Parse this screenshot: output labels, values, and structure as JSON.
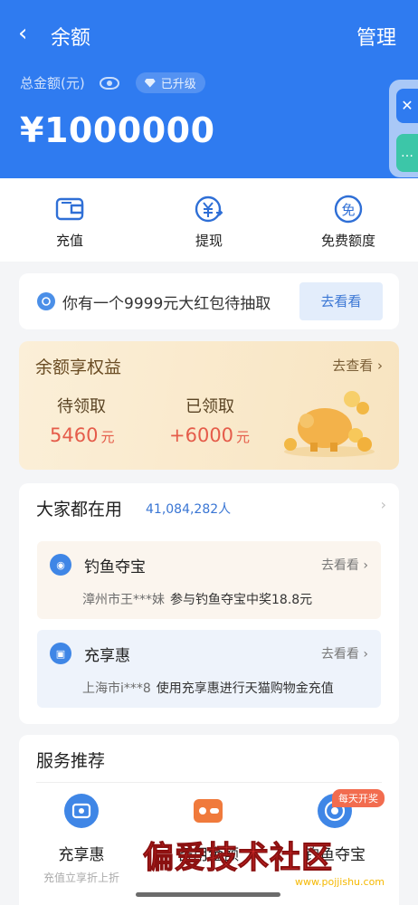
{
  "header": {
    "title": "余额",
    "manage": "管理",
    "total_label": "总金额(元)",
    "upgraded_badge": "已升级",
    "amount": "¥1000000"
  },
  "actions": [
    {
      "label": "充值",
      "icon": "wallet-icon"
    },
    {
      "label": "提现",
      "icon": "yuan-withdraw-icon"
    },
    {
      "label": "免费额度",
      "icon": "free-quota-icon"
    }
  ],
  "promo": {
    "text": "你有一个9999元大红包待抽取",
    "button": "去看看"
  },
  "rights": {
    "title": "余额享权益",
    "link": "去查看",
    "pending_label": "待领取",
    "pending_value": "5460",
    "received_label": "已领取",
    "received_value": "+6000",
    "unit": "元"
  },
  "popular": {
    "title": "大家都在用",
    "count": "41,084,282人",
    "items": [
      {
        "name": "钓鱼夺宝",
        "link": "去看看",
        "city": "漳州市王***妹",
        "desc": "参与钓鱼夺宝中奖18.8元"
      },
      {
        "name": "充享惠",
        "link": "去看看",
        "city": "上海市i***8",
        "desc": "使用充享惠进行天猫购物金充值"
      }
    ]
  },
  "services": {
    "title": "服务推荐",
    "badge": "每天开奖",
    "items": [
      {
        "label": "充享惠",
        "sub": "充值立享折上折"
      },
      {
        "label": "备用金额",
        "sub": ""
      },
      {
        "label": "钓鱼夺宝",
        "sub": ""
      }
    ]
  },
  "watermark": {
    "text": "偏爱技术社区",
    "url": "www.pojjishu.com"
  },
  "colors": {
    "brand_blue": "#2f7bf0",
    "rights_bg": "#f8e4c0",
    "red_value": "#e55c4a"
  }
}
